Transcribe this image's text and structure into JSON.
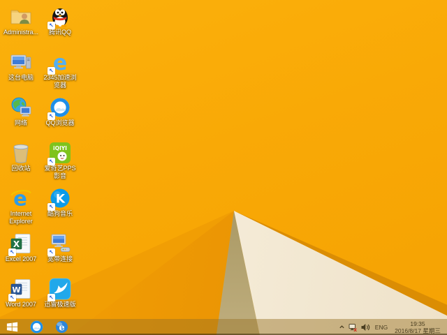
{
  "wallpaper": {
    "base_color": "#F8A705",
    "fold_white": "#F5EEDC",
    "fold_shadow": "#9C8B58",
    "fold_dark_edge": "#DB8D04"
  },
  "desktop": {
    "icons": [
      {
        "id": "administrator",
        "label": "Administra...",
        "kind": "folder-user",
        "col": 1,
        "row": 1,
        "shortcut": false
      },
      {
        "id": "tencent-qq",
        "label": "腾讯QQ",
        "kind": "qq-penguin",
        "col": 2,
        "row": 1,
        "shortcut": true
      },
      {
        "id": "this-pc",
        "label": "这台电脑",
        "kind": "computer",
        "col": 1,
        "row": 2,
        "shortcut": false
      },
      {
        "id": "2345-browser",
        "label": "2345加速浏览器",
        "kind": "e-light",
        "col": 2,
        "row": 2,
        "shortcut": true
      },
      {
        "id": "network",
        "label": "网络",
        "kind": "network-globe",
        "col": 1,
        "row": 3,
        "shortcut": false
      },
      {
        "id": "qq-browser",
        "label": "QQ浏览器",
        "kind": "qq-cloud",
        "col": 2,
        "row": 3,
        "shortcut": true
      },
      {
        "id": "recycle-bin",
        "label": "回收站",
        "kind": "recycle-bin",
        "col": 1,
        "row": 4,
        "shortcut": false
      },
      {
        "id": "iqiyi-pps",
        "label": "爱奇艺PPS 影音",
        "kind": "iqiyi",
        "col": 2,
        "row": 4,
        "shortcut": true
      },
      {
        "id": "internet-explorer",
        "label": "Internet Explorer",
        "kind": "ie",
        "col": 1,
        "row": 5,
        "shortcut": false
      },
      {
        "id": "kugou-music",
        "label": "酷狗音乐",
        "kind": "kugou",
        "col": 2,
        "row": 5,
        "shortcut": true
      },
      {
        "id": "excel-2007",
        "label": "Excel 2007",
        "kind": "excel",
        "col": 1,
        "row": 6,
        "shortcut": true
      },
      {
        "id": "broadband",
        "label": "宽带连接",
        "kind": "broadband",
        "col": 2,
        "row": 6,
        "shortcut": true
      },
      {
        "id": "word-2007",
        "label": "Word 2007",
        "kind": "word",
        "col": 1,
        "row": 7,
        "shortcut": true
      },
      {
        "id": "xunlei",
        "label": "迅雷极速版",
        "kind": "xunlei",
        "col": 2,
        "row": 7,
        "shortcut": true
      }
    ]
  },
  "taskbar": {
    "pinned": [
      {
        "id": "qq-browser",
        "kind": "qq-cloud"
      },
      {
        "id": "internet-explorer",
        "kind": "ie-ball"
      }
    ],
    "tray": {
      "language": "ENG",
      "time": "19:35",
      "date": "2016/8/17 星期三"
    }
  }
}
